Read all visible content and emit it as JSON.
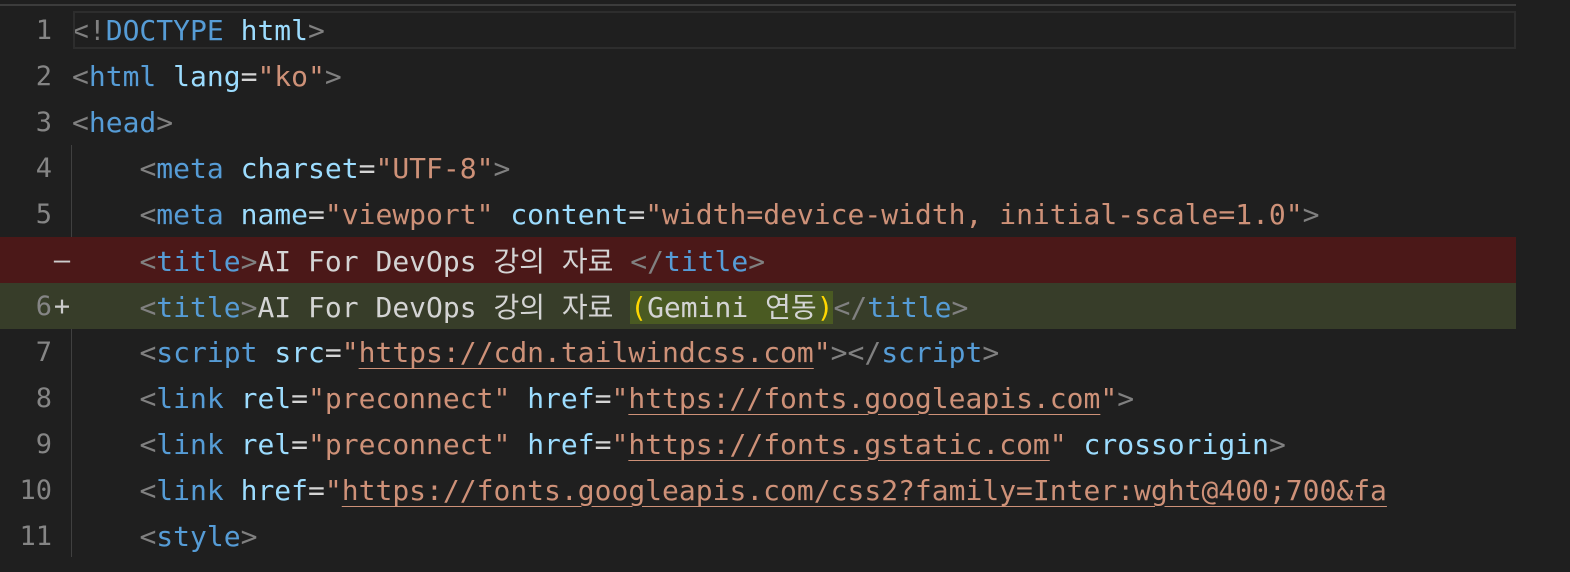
{
  "editor": {
    "lines": [
      {
        "num": "1",
        "marker": ""
      },
      {
        "num": "2",
        "marker": ""
      },
      {
        "num": "3",
        "marker": ""
      },
      {
        "num": "4",
        "marker": ""
      },
      {
        "num": "5",
        "marker": ""
      },
      {
        "num": "",
        "marker": "—"
      },
      {
        "num": "6",
        "marker": "+"
      },
      {
        "num": "7",
        "marker": ""
      },
      {
        "num": "8",
        "marker": ""
      },
      {
        "num": "9",
        "marker": ""
      },
      {
        "num": "10",
        "marker": ""
      },
      {
        "num": "11",
        "marker": ""
      }
    ],
    "code": {
      "l1": {
        "open": "<!",
        "doctype": "DOCTYPE",
        "sp": " ",
        "html": "html",
        "close": ">"
      },
      "l2": {
        "open": "<",
        "tag": "html",
        "sp": " ",
        "attr": "lang",
        "eq": "=",
        "val": "\"ko\"",
        "close": ">"
      },
      "l3": {
        "open": "<",
        "tag": "head",
        "close": ">"
      },
      "l4": {
        "indent": "    ",
        "open": "<",
        "tag": "meta",
        "sp": " ",
        "attr": "charset",
        "eq": "=",
        "val": "\"UTF-8\"",
        "close": ">"
      },
      "l5": {
        "indent": "    ",
        "open": "<",
        "tag": "meta",
        "sp1": " ",
        "attr1": "name",
        "eq1": "=",
        "val1": "\"viewport\"",
        "sp2": " ",
        "attr2": "content",
        "eq2": "=",
        "val2": "\"width=device-width, initial-scale=1.0\"",
        "close": ">"
      },
      "l6_removed": {
        "indent": "    ",
        "open": "<",
        "tag": "title",
        "close": ">",
        "text": "AI For DevOps 강의 자료 ",
        "eopen": "</",
        "etag": "title",
        "eclose": ">"
      },
      "l6_added": {
        "indent": "    ",
        "open": "<",
        "tag": "title",
        "close": ">",
        "text": "AI For DevOps 강의 자료 ",
        "paren_open": "(",
        "added": "Gemini 연동",
        "paren_close": ")",
        "eopen": "</",
        "etag": "title",
        "eclose": ">"
      },
      "l7": {
        "indent": "    ",
        "open": "<",
        "tag": "script",
        "sp": " ",
        "attr": "src",
        "eq": "=",
        "q1": "\"",
        "url": "https://cdn.tailwindcss.com",
        "q2": "\"",
        "close": ">",
        "eopen": "</",
        "etag": "script",
        "eclose": ">"
      },
      "l8": {
        "indent": "    ",
        "open": "<",
        "tag": "link",
        "sp1": " ",
        "attr1": "rel",
        "eq1": "=",
        "val1": "\"preconnect\"",
        "sp2": " ",
        "attr2": "href",
        "eq2": "=",
        "q1": "\"",
        "url": "https://fonts.googleapis.com",
        "q2": "\"",
        "close": ">"
      },
      "l9": {
        "indent": "    ",
        "open": "<",
        "tag": "link",
        "sp1": " ",
        "attr1": "rel",
        "eq1": "=",
        "val1": "\"preconnect\"",
        "sp2": " ",
        "attr2": "href",
        "eq2": "=",
        "q1": "\"",
        "url": "https://fonts.gstatic.com",
        "q2": "\"",
        "sp3": " ",
        "attr3": "crossorigin",
        "close": ">"
      },
      "l10": {
        "indent": "    ",
        "open": "<",
        "tag": "link",
        "sp": " ",
        "attr": "href",
        "eq": "=",
        "q1": "\"",
        "url": "https://fonts.googleapis.com/css2?family=Inter:wght@400;700&fa"
      },
      "l11": {
        "indent": "    ",
        "open": "<",
        "tag": "style",
        "close": ">"
      }
    }
  }
}
